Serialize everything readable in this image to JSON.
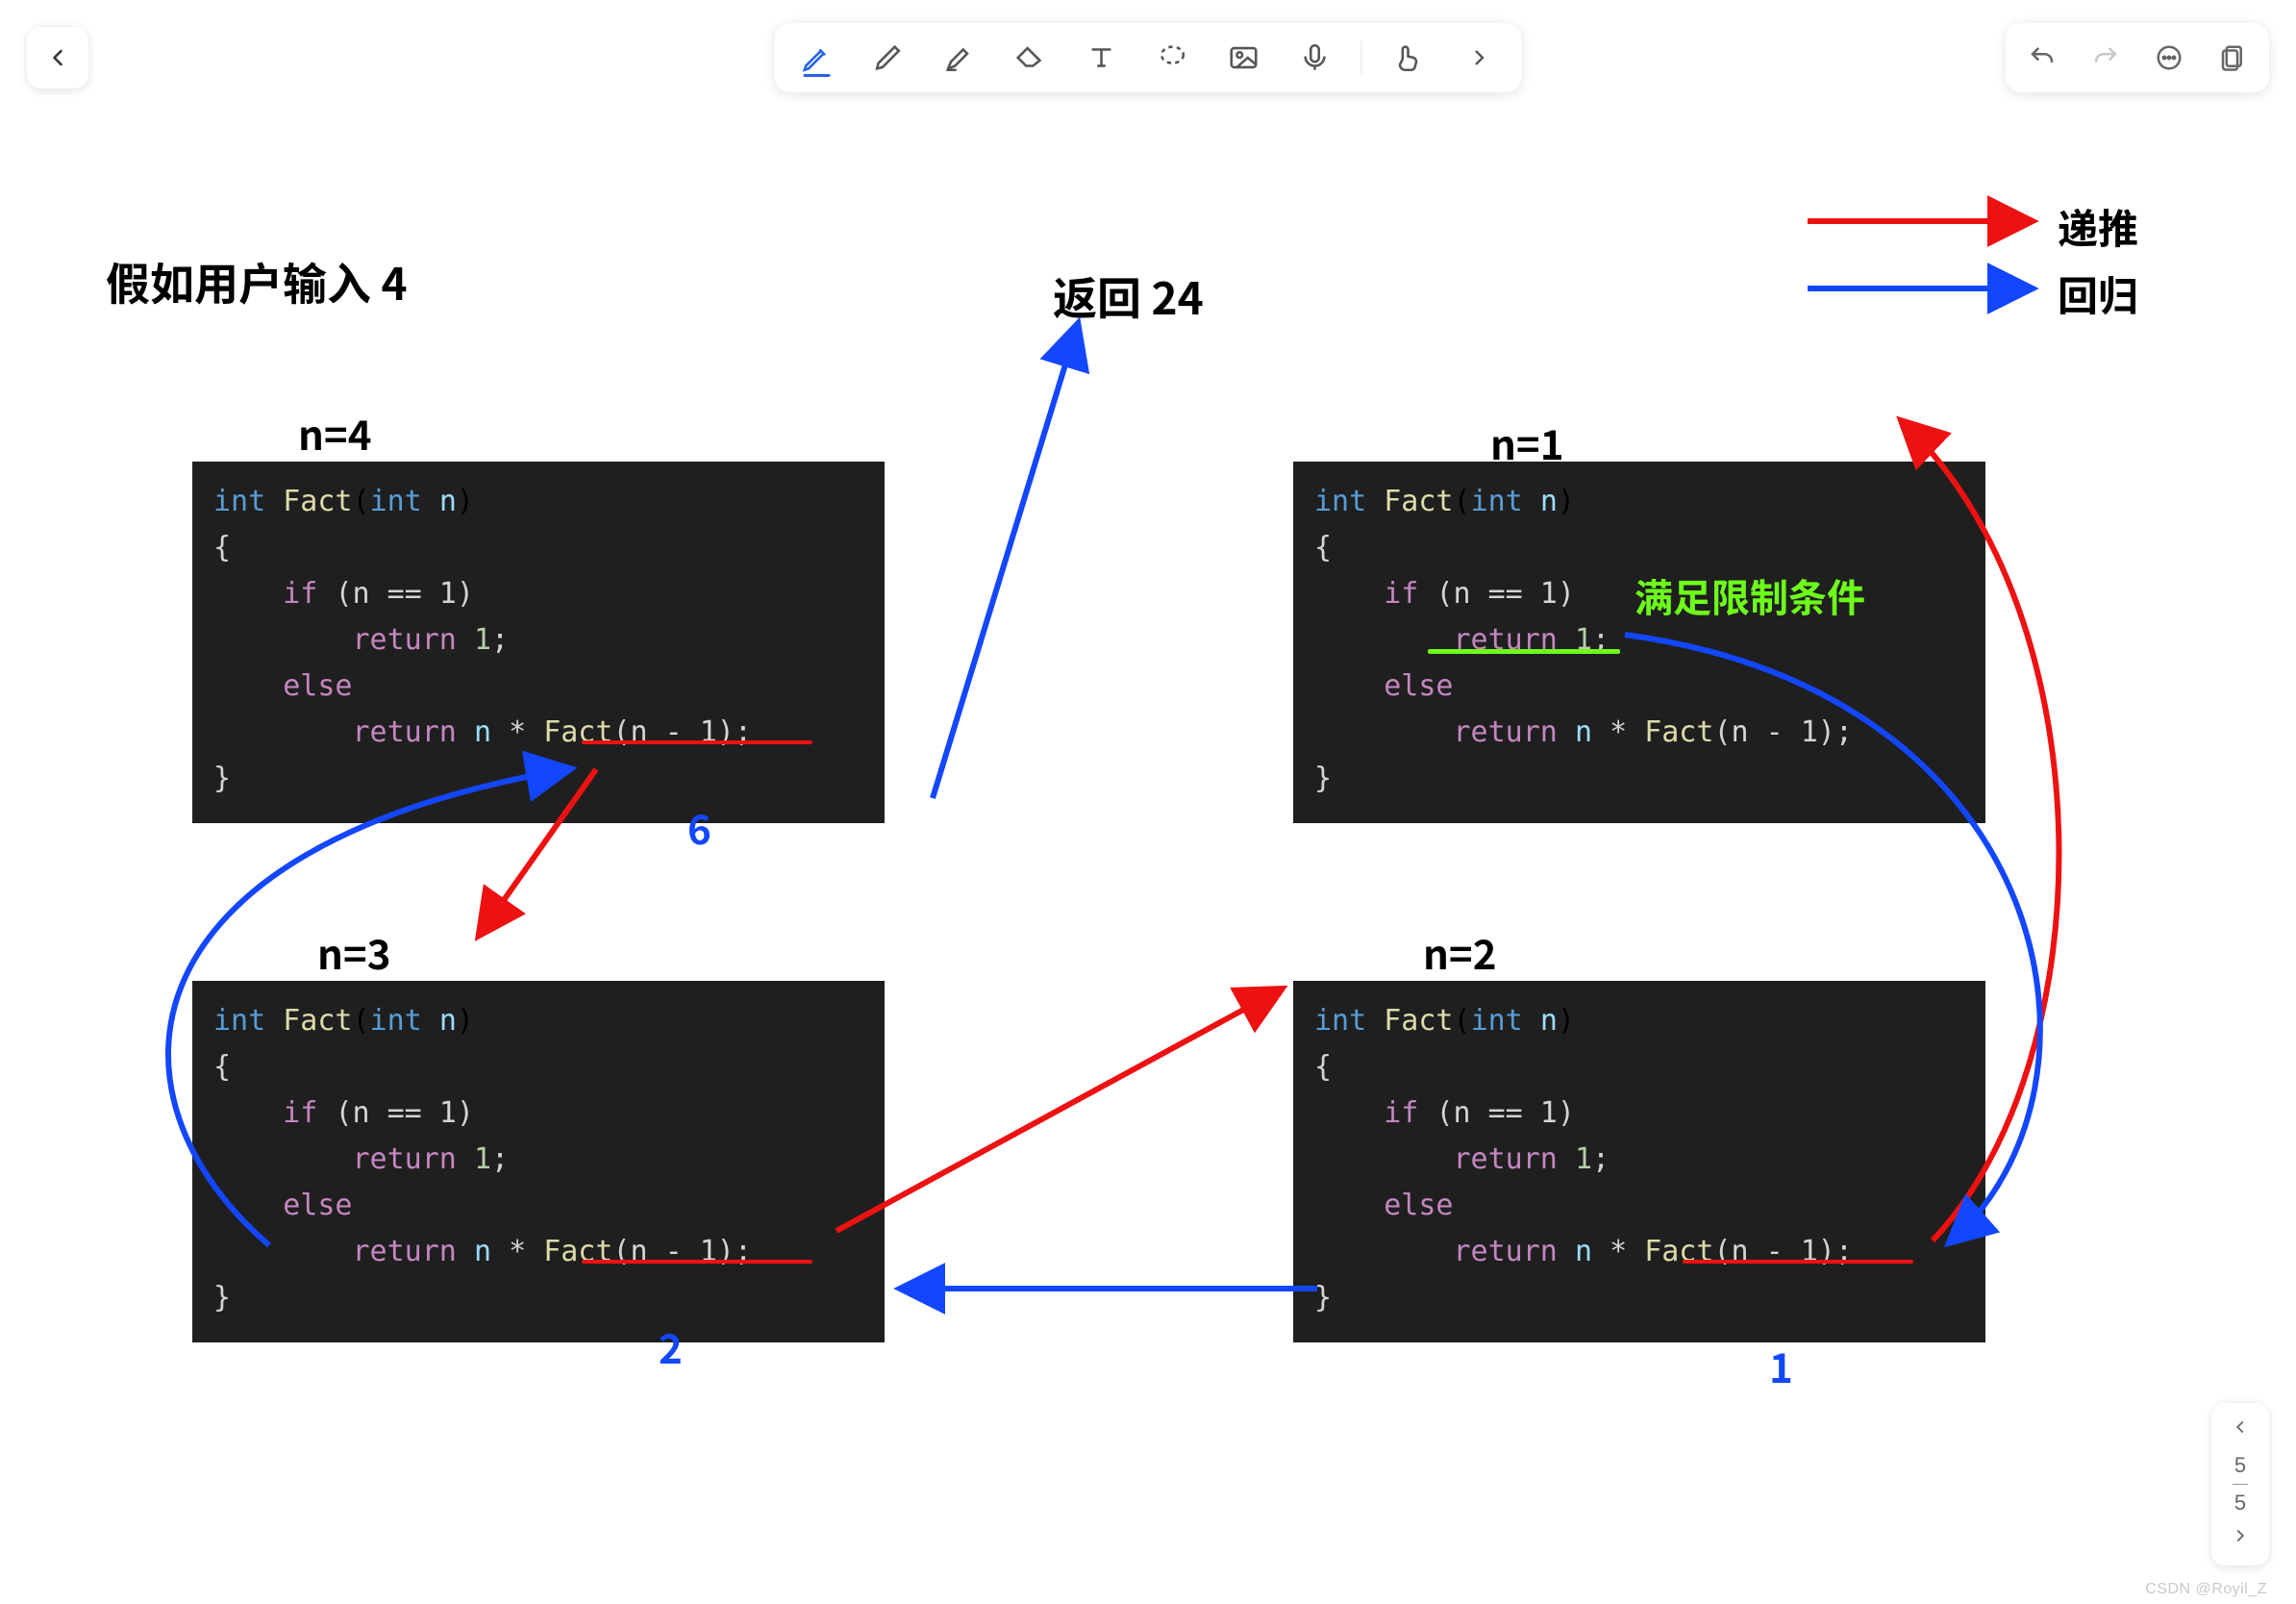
{
  "toolbar": {
    "tools": [
      "pen",
      "pencil",
      "highlighter",
      "eraser",
      "text",
      "lasso",
      "image",
      "mic",
      "sep",
      "finger",
      "more"
    ],
    "active_index": 0
  },
  "rightbar": {
    "items": [
      "undo",
      "redo",
      "more",
      "pages"
    ]
  },
  "page_nav": {
    "current": "5",
    "total": "5"
  },
  "watermark": "CSDN @Royil_Z",
  "legend": {
    "red_label": "递推",
    "blue_label": "回归"
  },
  "heading": "假如用户输入 4",
  "result_label": "返回 24",
  "green_note": "满足限制条件",
  "boxes": {
    "n4": {
      "title": "n=4",
      "under_val": "6"
    },
    "n3": {
      "title": "n=3",
      "under_val": "2"
    },
    "n2": {
      "title": "n=2",
      "under_val": "1"
    },
    "n1": {
      "title": "n=1"
    }
  },
  "code": {
    "sig_int": "int",
    "sig_fn": "Fact",
    "sig_param_type": "int",
    "sig_param_name": "n",
    "brace_open": "{",
    "if_kw": "if",
    "cond": "(n == 1)",
    "ret1": "return",
    "one": "1",
    "else_kw": "else",
    "ret2": "return",
    "expr_n": "n",
    "star": "*",
    "call_fn": "Fact",
    "call_arg": "(n - 1)",
    "semi": ";",
    "brace_close": "}"
  }
}
